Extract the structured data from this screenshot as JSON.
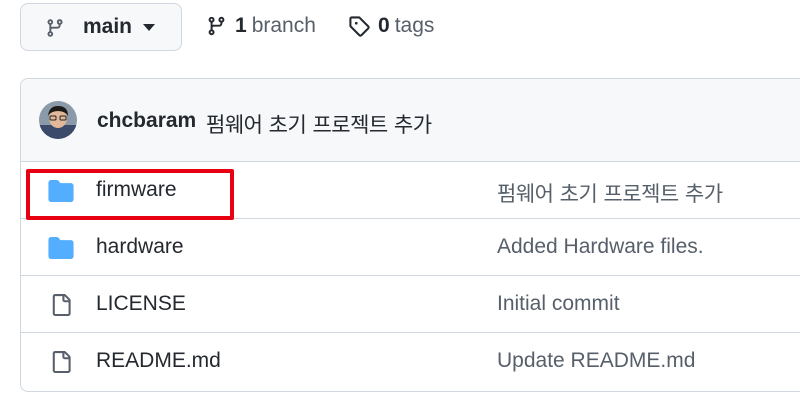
{
  "branch_selector": {
    "current": "main"
  },
  "repo_meta": {
    "branch_count": "1",
    "branch_label": "branch",
    "tag_count": "0",
    "tag_label": "tags"
  },
  "latest_commit": {
    "author": "chcbaram",
    "message": "펌웨어 초기 프로젝트 추가"
  },
  "files": [
    {
      "type": "folder",
      "name": "firmware",
      "commit": "펌웨어 초기 프로젝트 추가",
      "highlighted": true
    },
    {
      "type": "folder",
      "name": "hardware",
      "commit": "Added Hardware files."
    },
    {
      "type": "file",
      "name": "LICENSE",
      "commit": "Initial commit"
    },
    {
      "type": "file",
      "name": "README.md",
      "commit": "Update README.md"
    }
  ],
  "colors": {
    "folder": "#54aeff",
    "highlight": "#e60012",
    "muted": "#57606a"
  }
}
